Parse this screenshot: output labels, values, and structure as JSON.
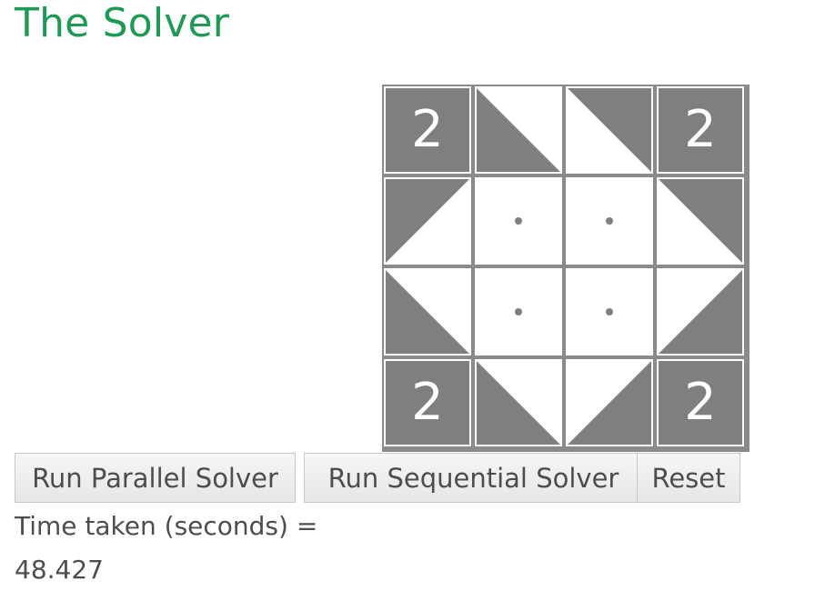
{
  "page": {
    "title": "The Solver"
  },
  "board": {
    "rows": 4,
    "cols": 4,
    "cells": [
      {
        "kind": "black",
        "number": "2"
      },
      {
        "kind": "tri",
        "dark_corner": "bottom-left"
      },
      {
        "kind": "tri",
        "dark_corner": "top-right"
      },
      {
        "kind": "black",
        "number": "2"
      },
      {
        "kind": "tri",
        "dark_corner": "top-left"
      },
      {
        "kind": "dot"
      },
      {
        "kind": "dot"
      },
      {
        "kind": "tri",
        "dark_corner": "top-right"
      },
      {
        "kind": "tri",
        "dark_corner": "bottom-left"
      },
      {
        "kind": "dot"
      },
      {
        "kind": "dot"
      },
      {
        "kind": "tri",
        "dark_corner": "bottom-right"
      },
      {
        "kind": "black",
        "number": "2"
      },
      {
        "kind": "tri",
        "dark_corner": "bottom-left"
      },
      {
        "kind": "tri",
        "dark_corner": "bottom-right"
      },
      {
        "kind": "black",
        "number": "2"
      }
    ],
    "colors": {
      "dark": "#7f7f7f",
      "light": "#ffffff",
      "grid": "#8a8a8a",
      "dot": "#7f7f7f"
    }
  },
  "controls": {
    "parallel_label": "Run Parallel Solver",
    "sequential_label": "Run Sequential Solver",
    "reset_label": "Reset"
  },
  "result": {
    "time_label": "Time taken (seconds) =",
    "time_value": "48.427"
  },
  "theme": {
    "title_color": "#1f9a55",
    "text_color": "#4d4d4d"
  }
}
